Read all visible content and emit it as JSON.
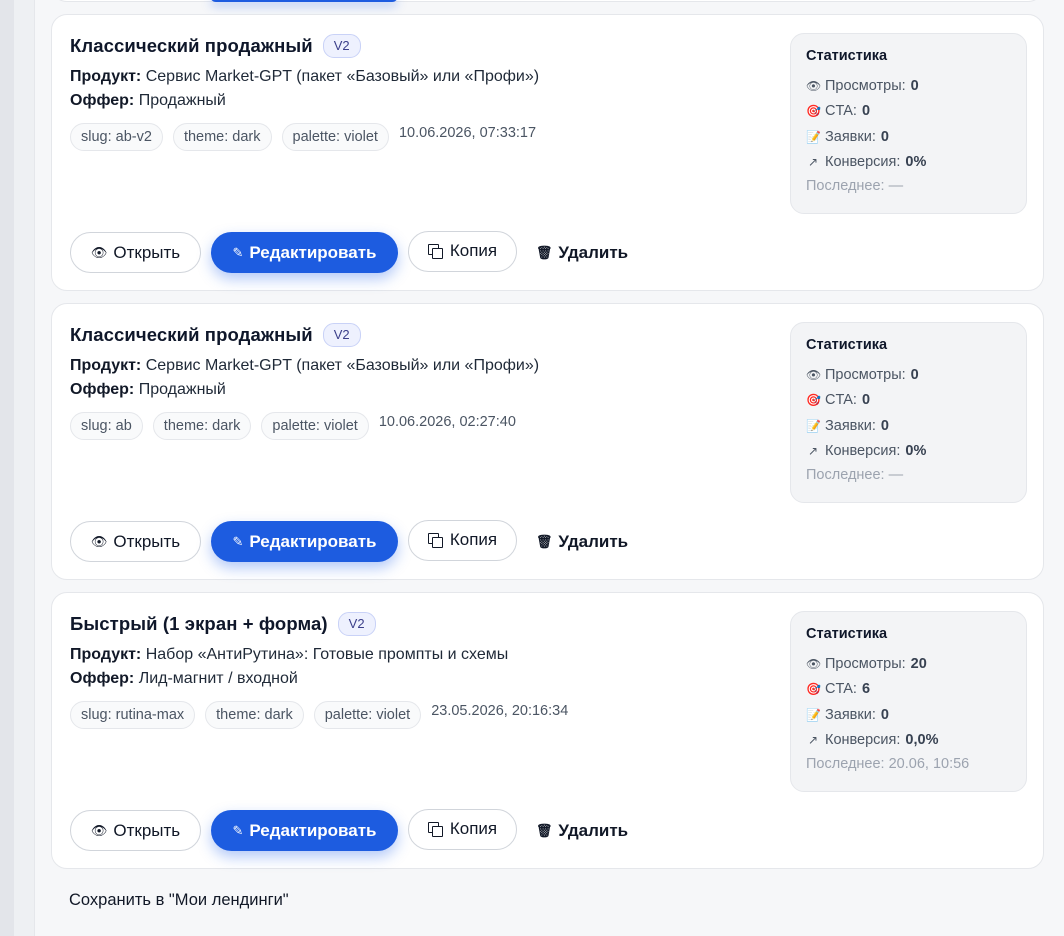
{
  "cards": [
    {
      "title": "Классический продажный",
      "version": "V2",
      "product_label": "Продукт:",
      "product": "Сервис Market-GPT (пакет «Базовый» или «Профи»)",
      "offer_label": "Оффер:",
      "offer": "Продажный",
      "tags": [
        "slug: ab-v2",
        "theme: dark",
        "palette: violet"
      ],
      "date": "10.06.2026, 07:33:17",
      "stats": {
        "title": "Статистика",
        "views_label": "Просмотры:",
        "views": "0",
        "cta_label": "CTA:",
        "cta": "0",
        "leads_label": "Заявки:",
        "leads": "0",
        "conversion_label": "Конверсия:",
        "conversion": "0%",
        "last": "Последнее: —"
      }
    },
    {
      "title": "Классический продажный",
      "version": "V2",
      "product_label": "Продукт:",
      "product": "Сервис Market-GPT (пакет «Базовый» или «Профи»)",
      "offer_label": "Оффер:",
      "offer": "Продажный",
      "tags": [
        "slug: ab",
        "theme: dark",
        "palette: violet"
      ],
      "date": "10.06.2026, 02:27:40",
      "stats": {
        "title": "Статистика",
        "views_label": "Просмотры:",
        "views": "0",
        "cta_label": "CTA:",
        "cta": "0",
        "leads_label": "Заявки:",
        "leads": "0",
        "conversion_label": "Конверсия:",
        "conversion": "0%",
        "last": "Последнее: —"
      }
    },
    {
      "title": "Быстрый (1 экран + форма)",
      "version": "V2",
      "product_label": "Продукт:",
      "product": "Набор «АнтиРутина»: Готовые промпты и схемы",
      "offer_label": "Оффер:",
      "offer": "Лид-магнит / входной",
      "tags": [
        "slug: rutina-max",
        "theme: dark",
        "palette: violet"
      ],
      "date": "23.05.2026, 20:16:34",
      "stats": {
        "title": "Статистика",
        "views_label": "Просмотры:",
        "views": "20",
        "cta_label": "CTA:",
        "cta": "6",
        "leads_label": "Заявки:",
        "leads": "0",
        "conversion_label": "Конверсия:",
        "conversion": "0,0%",
        "last": "Последнее: 20.06, 10:56"
      }
    }
  ],
  "actions": {
    "open": "Открыть",
    "edit": "Редактировать",
    "copy": "Копия",
    "delete": "Удалить"
  },
  "icons": {
    "open": "eye-icon",
    "edit": "pencil-icon",
    "copy": "copy-icon",
    "delete": "trash-icon",
    "views": "eye-icon",
    "cta": "target-icon",
    "leads": "memo-icon",
    "conversion": "trend-up-icon"
  },
  "colors": {
    "primary": "#1d5ce0",
    "card_bg": "#ffffff",
    "stats_bg": "#f3f4f6"
  },
  "footer": {
    "save_label": "Сохранить в \"Мои лендинги\""
  }
}
